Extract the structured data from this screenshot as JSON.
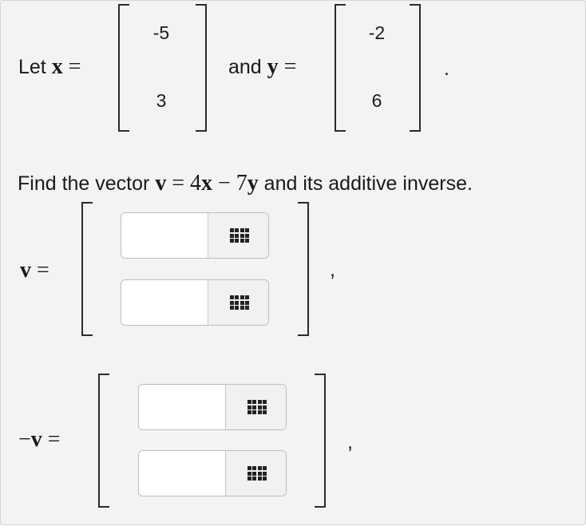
{
  "given": {
    "let_text": "Let",
    "x_var": "x",
    "equals": "=",
    "x_entries": [
      "-5",
      "3"
    ],
    "and_text": "and",
    "y_var": "y",
    "y_entries": [
      "-2",
      "6"
    ],
    "period": "."
  },
  "prompt": {
    "find_text": "Find the vector",
    "v_var": "v",
    "equals": "=",
    "coef_x": "4",
    "x_var": "x",
    "minus": "−",
    "coef_y": "7",
    "y_var": "y",
    "tail_text": "and its additive inverse."
  },
  "answer_v": {
    "label_var": "v",
    "equals": "=",
    "entries": [
      "",
      ""
    ],
    "comma": ","
  },
  "answer_neg_v": {
    "label_minus": "−",
    "label_var": "v",
    "equals": "=",
    "entries": [
      "",
      ""
    ],
    "comma": ","
  }
}
